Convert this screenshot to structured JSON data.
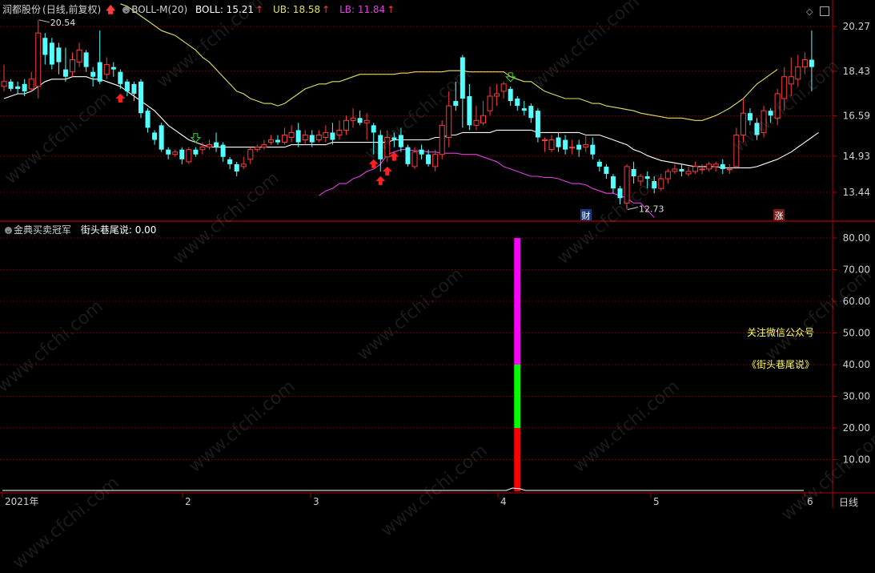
{
  "stock": {
    "name": "润都股份",
    "mode": "(日线,前复权)",
    "indicator": "BOLL-M(20)",
    "boll_label": "BOLL: 15.21",
    "ub_label": "UB: 18.58",
    "lb_label": "LB: 11.84",
    "up_arrow": "↑"
  },
  "lower": {
    "name": "金典买卖冠军",
    "value_label": "街头巷尾说: 0.00",
    "note1": "关注微信公众号",
    "note2": "《街头巷尾说》"
  },
  "markers": {
    "cai": "财",
    "zhang": "涨",
    "high": "20.54",
    "low": "12.73"
  },
  "x_axis": [
    "2021年",
    "2",
    "3",
    "4",
    "5",
    "6"
  ],
  "period_label": "日线",
  "watermark": "www.cfchi.com",
  "colors": {
    "up": "#ff3b3b",
    "down": "#54ffff",
    "boll": "#ffffff",
    "ub": "#e0e060",
    "lb": "#e040e0",
    "axis": "#b00000",
    "text": "#cfcfcf"
  },
  "chart_data": [
    {
      "type": "candlestick",
      "title": "润都股份(日线,前复权)",
      "yticks": [
        20.27,
        18.43,
        16.59,
        14.93,
        13.44
      ],
      "ylim": [
        12.15,
        21.2
      ],
      "candles": [
        [
          17.8,
          18.0,
          18.7,
          17.6
        ],
        [
          18.0,
          17.7,
          18.1,
          17.6
        ],
        [
          17.8,
          17.7,
          18.0,
          17.5
        ],
        [
          17.9,
          17.6,
          18.1,
          17.4
        ],
        [
          17.7,
          18.1,
          18.4,
          17.6
        ],
        [
          17.8,
          20.0,
          20.54,
          17.3
        ],
        [
          19.8,
          19.1,
          20.0,
          18.7
        ],
        [
          19.6,
          18.7,
          19.8,
          18.5
        ],
        [
          19.4,
          18.8,
          19.6,
          18.3
        ],
        [
          18.5,
          18.2,
          19.4,
          18.0
        ],
        [
          18.4,
          18.9,
          19.2,
          18.2
        ],
        [
          18.8,
          19.3,
          19.6,
          18.6
        ],
        [
          19.2,
          18.6,
          19.3,
          18.4
        ],
        [
          18.4,
          18.2,
          18.6,
          17.8
        ],
        [
          18.8,
          18.0,
          20.1,
          17.9
        ],
        [
          18.3,
          18.7,
          19.0,
          18.1
        ],
        [
          18.6,
          18.5,
          18.8,
          18.2
        ],
        [
          18.4,
          17.9,
          18.5,
          17.7
        ],
        [
          18.0,
          17.6,
          18.1,
          17.4
        ],
        [
          17.9,
          17.5,
          18.0,
          17.2
        ],
        [
          18.0,
          16.7,
          18.1,
          16.5
        ],
        [
          16.8,
          16.1,
          16.9,
          15.9
        ],
        [
          15.9,
          15.6,
          16.0,
          15.4
        ],
        [
          16.2,
          15.2,
          16.3,
          15.1
        ],
        [
          15.2,
          15.0,
          15.3,
          14.8
        ],
        [
          15.0,
          15.1,
          15.2,
          14.9
        ],
        [
          15.2,
          14.8,
          15.3,
          14.6
        ],
        [
          14.7,
          15.2,
          15.3,
          14.6
        ],
        [
          15.2,
          15.0,
          15.3,
          14.9
        ],
        [
          15.2,
          15.3,
          15.5,
          15.0
        ],
        [
          15.3,
          15.4,
          15.6,
          15.2
        ],
        [
          15.5,
          15.3,
          15.9,
          15.1
        ],
        [
          15.4,
          14.9,
          15.5,
          14.7
        ],
        [
          14.8,
          14.6,
          14.9,
          14.4
        ],
        [
          14.6,
          14.3,
          14.7,
          14.1
        ],
        [
          14.5,
          14.6,
          14.9,
          14.4
        ],
        [
          14.8,
          15.2,
          15.3,
          14.6
        ],
        [
          15.2,
          15.3,
          15.4,
          15.1
        ],
        [
          15.3,
          15.4,
          15.6,
          15.2
        ],
        [
          15.5,
          15.6,
          15.8,
          15.4
        ],
        [
          15.6,
          15.5,
          15.8,
          15.4
        ],
        [
          15.5,
          15.8,
          16.1,
          15.4
        ],
        [
          15.7,
          15.9,
          16.2,
          15.5
        ],
        [
          16.0,
          15.5,
          16.3,
          15.3
        ],
        [
          15.6,
          15.8,
          16.0,
          15.4
        ],
        [
          15.8,
          15.5,
          16.0,
          15.3
        ],
        [
          15.6,
          15.8,
          16.0,
          15.5
        ],
        [
          15.7,
          15.9,
          16.2,
          15.5
        ],
        [
          15.9,
          15.6,
          16.3,
          15.4
        ],
        [
          15.8,
          16.0,
          16.4,
          15.6
        ],
        [
          16.0,
          16.4,
          16.6,
          15.8
        ],
        [
          16.4,
          16.5,
          16.9,
          16.1
        ],
        [
          16.5,
          16.3,
          16.8,
          16.2
        ],
        [
          16.3,
          16.4,
          16.7,
          15.6
        ],
        [
          16.2,
          15.9,
          16.3,
          15.0
        ],
        [
          15.8,
          14.8,
          16.0,
          14.3
        ],
        [
          14.9,
          15.7,
          16.0,
          14.7
        ],
        [
          15.7,
          15.6,
          15.9,
          15.3
        ],
        [
          15.8,
          15.3,
          16.1,
          15.1
        ],
        [
          15.3,
          14.6,
          15.4,
          14.5
        ],
        [
          14.5,
          15.1,
          15.3,
          14.4
        ],
        [
          15.2,
          15.0,
          15.4,
          14.8
        ],
        [
          15.0,
          14.6,
          15.2,
          14.5
        ],
        [
          14.5,
          15.0,
          15.2,
          14.3
        ],
        [
          15.0,
          16.2,
          16.4,
          14.8
        ],
        [
          15.7,
          17.0,
          17.6,
          15.3
        ],
        [
          17.2,
          17.0,
          18.0,
          16.8
        ],
        [
          19.0,
          17.3,
          19.1,
          16.1
        ],
        [
          17.4,
          16.2,
          17.9,
          16.0
        ],
        [
          16.2,
          16.4,
          17.0,
          16.0
        ],
        [
          16.3,
          16.6,
          17.2,
          16.2
        ],
        [
          16.8,
          17.4,
          17.8,
          16.6
        ],
        [
          17.4,
          17.5,
          17.9,
          17.0
        ],
        [
          17.6,
          17.9,
          18.0,
          17.3
        ],
        [
          17.7,
          17.2,
          17.8,
          17.0
        ],
        [
          17.3,
          17.0,
          17.4,
          16.8
        ],
        [
          16.9,
          16.8,
          17.2,
          16.6
        ],
        [
          17.0,
          16.5,
          17.1,
          16.3
        ],
        [
          16.8,
          15.7,
          16.9,
          15.5
        ],
        [
          15.6,
          15.6,
          15.7,
          15.1
        ],
        [
          15.2,
          15.6,
          15.8,
          15.1
        ],
        [
          15.7,
          15.3,
          15.9,
          15.1
        ],
        [
          15.6,
          15.2,
          15.8,
          15.0
        ],
        [
          15.3,
          15.3,
          15.6,
          15.0
        ],
        [
          15.4,
          15.2,
          15.6,
          14.9
        ],
        [
          15.3,
          15.4,
          15.8,
          15.1
        ],
        [
          15.4,
          15.0,
          15.7,
          14.8
        ],
        [
          14.7,
          14.5,
          14.8,
          14.3
        ],
        [
          14.5,
          14.2,
          14.6,
          14.0
        ],
        [
          14.1,
          13.6,
          14.2,
          13.4
        ],
        [
          13.6,
          13.2,
          13.7,
          12.95
        ],
        [
          13.0,
          14.5,
          14.6,
          12.73
        ],
        [
          14.4,
          14.1,
          14.7,
          13.8
        ],
        [
          13.9,
          14.1,
          14.2,
          13.7
        ],
        [
          14.1,
          14.0,
          14.3,
          13.6
        ],
        [
          13.9,
          13.6,
          14.1,
          13.4
        ],
        [
          13.6,
          14.0,
          14.2,
          13.5
        ],
        [
          14.0,
          14.3,
          14.4,
          13.8
        ],
        [
          14.3,
          14.4,
          14.6,
          14.2
        ],
        [
          14.4,
          14.3,
          14.6,
          14.1
        ],
        [
          14.2,
          14.3,
          14.5,
          14.1
        ],
        [
          14.3,
          14.5,
          14.7,
          14.2
        ],
        [
          14.4,
          14.4,
          14.6,
          14.2
        ],
        [
          14.4,
          14.6,
          14.7,
          14.3
        ],
        [
          14.5,
          14.6,
          14.7,
          14.3
        ],
        [
          14.6,
          14.4,
          14.8,
          14.2
        ],
        [
          14.4,
          14.4,
          14.6,
          14.2
        ],
        [
          14.5,
          15.8,
          16.1,
          14.4
        ],
        [
          15.8,
          16.7,
          17.3,
          15.5
        ],
        [
          16.7,
          16.4,
          16.9,
          16.2
        ],
        [
          16.3,
          15.8,
          16.5,
          15.6
        ],
        [
          15.9,
          16.8,
          17.0,
          15.7
        ],
        [
          16.8,
          16.6,
          16.9,
          16.3
        ],
        [
          16.5,
          17.5,
          17.7,
          16.2
        ],
        [
          17.3,
          18.2,
          18.6,
          16.8
        ],
        [
          17.9,
          18.2,
          19.0,
          17.4
        ],
        [
          18.1,
          18.6,
          19.1,
          17.8
        ],
        [
          18.6,
          18.9,
          19.2,
          18.3
        ],
        [
          18.9,
          18.6,
          20.1,
          17.6
        ]
      ],
      "boll": [
        17.3,
        17.4,
        17.5,
        17.5,
        17.6,
        17.8,
        18.0,
        18.1,
        18.1,
        18.1,
        18.2,
        18.2,
        18.2,
        18.1,
        18.1,
        18.0,
        17.9,
        17.8,
        17.6,
        17.4,
        17.2,
        17.0,
        16.8,
        16.5,
        16.2,
        16.0,
        15.8,
        15.6,
        15.5,
        15.4,
        15.3,
        15.3,
        15.3,
        15.3,
        15.3,
        15.3,
        15.3,
        15.3,
        15.3,
        15.3,
        15.3,
        15.3,
        15.4,
        15.4,
        15.4,
        15.4,
        15.4,
        15.4,
        15.5,
        15.5,
        15.5,
        15.5,
        15.5,
        15.5,
        15.5,
        15.5,
        15.5,
        15.6,
        15.6,
        15.6,
        15.6,
        15.6,
        15.6,
        15.7,
        15.7,
        15.8,
        15.8,
        15.9,
        15.9,
        15.9,
        15.9,
        15.9,
        16.0,
        16.0,
        16.0,
        16.0,
        16.0,
        16.0,
        15.9,
        15.9,
        15.9,
        15.9,
        15.9,
        15.9,
        15.9,
        15.8,
        15.8,
        15.8,
        15.7,
        15.6,
        15.5,
        15.4,
        15.2,
        15.1,
        14.95,
        14.85,
        14.75,
        14.7,
        14.65,
        14.6,
        14.55,
        14.5,
        14.5,
        14.5,
        14.5,
        14.45,
        14.45,
        14.45,
        14.45,
        14.45,
        14.5,
        14.6,
        14.7,
        14.8,
        14.95,
        15.1,
        15.3,
        15.5,
        15.7,
        15.9
      ],
      "ub": [
        null,
        null,
        null,
        null,
        null,
        null,
        null,
        null,
        null,
        null,
        null,
        null,
        null,
        null,
        null,
        null,
        null,
        21.2,
        21.1,
        20.9,
        20.7,
        20.5,
        20.3,
        20.1,
        20.0,
        19.9,
        19.7,
        19.5,
        19.3,
        19.0,
        18.8,
        18.5,
        18.2,
        17.9,
        17.6,
        17.5,
        17.3,
        17.2,
        17.1,
        17.1,
        17.0,
        17.1,
        17.3,
        17.5,
        17.7,
        17.8,
        17.9,
        17.9,
        18.0,
        18.0,
        18.1,
        18.2,
        18.3,
        18.3,
        18.3,
        18.3,
        18.3,
        18.3,
        18.35,
        18.35,
        18.4,
        18.4,
        18.4,
        18.4,
        18.4,
        18.45,
        18.45,
        18.45,
        18.4,
        18.4,
        18.4,
        18.4,
        18.4,
        18.4,
        18.2,
        18.1,
        18.0,
        18.0,
        17.8,
        17.6,
        17.5,
        17.4,
        17.3,
        17.3,
        17.3,
        17.2,
        17.1,
        17.1,
        17.0,
        16.95,
        16.9,
        16.85,
        16.8,
        16.7,
        16.65,
        16.6,
        16.55,
        16.5,
        16.5,
        16.5,
        16.45,
        16.4,
        16.4,
        16.5,
        16.6,
        16.75,
        16.9,
        17.1,
        17.3,
        17.6,
        17.9,
        18.1,
        18.3,
        18.5
      ],
      "lb": [
        null,
        null,
        null,
        null,
        null,
        null,
        null,
        null,
        null,
        null,
        null,
        null,
        null,
        null,
        null,
        null,
        null,
        null,
        null,
        null,
        null,
        null,
        null,
        null,
        null,
        null,
        null,
        null,
        null,
        null,
        null,
        null,
        null,
        null,
        null,
        null,
        null,
        null,
        null,
        null,
        null,
        null,
        12.6,
        12.7,
        12.9,
        13.1,
        13.3,
        13.5,
        13.6,
        13.8,
        13.8,
        14.0,
        14.1,
        14.3,
        14.4,
        14.6,
        15.0,
        15.1,
        15.2,
        15.2,
        15.15,
        15.15,
        15.1,
        15.1,
        15.05,
        15.05,
        15.05,
        15.0,
        15.0,
        15.0,
        14.9,
        14.8,
        14.7,
        14.5,
        14.4,
        14.3,
        14.2,
        14.1,
        14.1,
        14.05,
        14.05,
        14.0,
        13.9,
        13.8,
        13.8,
        13.75,
        13.6,
        13.5,
        13.4,
        13.4,
        13.3,
        13.2,
        13.0,
        13.0,
        12.7,
        12.4
      ],
      "ub_start_x": 176,
      "lb_start_x": 53,
      "lb_break_x": 323,
      "lb_restart_x": 398,
      "buy_signals": [
        17,
        54,
        55,
        56,
        57
      ],
      "sell_signals": [
        28,
        74
      ],
      "annotations": [
        {
          "text": "20.54",
          "at": "high"
        },
        {
          "text": "12.73",
          "at": "low"
        }
      ]
    },
    {
      "type": "bar",
      "title": "金典买卖冠军",
      "yticks": [
        80.0,
        70.0,
        60.0,
        50.0,
        40.0,
        30.0,
        20.0,
        10.0
      ],
      "ylim": [
        0,
        84
      ],
      "stacked_bar": {
        "at_candle": 75,
        "segments": [
          {
            "from": 0,
            "to": 20,
            "color": "#ff0000"
          },
          {
            "from": 20,
            "to": 40,
            "color": "#00ff00"
          },
          {
            "from": 40,
            "to": 80,
            "color": "#ff00ff"
          }
        ]
      },
      "line_value": 0.0
    }
  ]
}
